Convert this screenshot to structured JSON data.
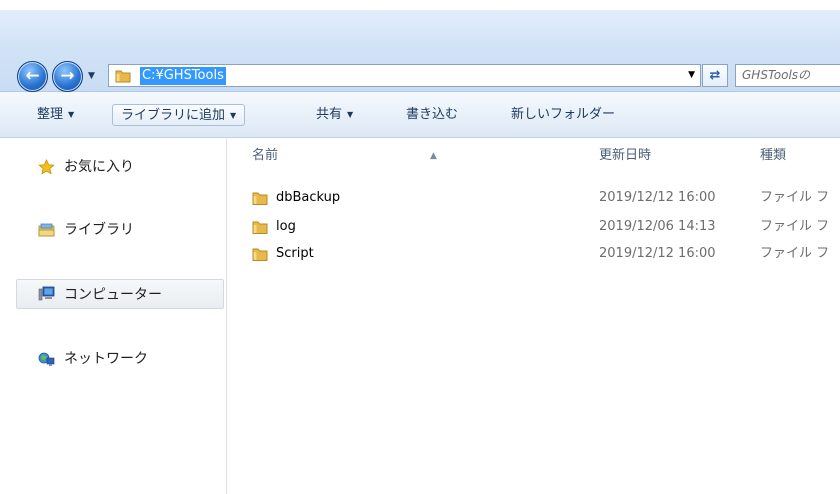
{
  "address": {
    "path": "C:¥GHSTools",
    "search_placeholder": "GHSToolsの"
  },
  "icons": {
    "back": "back-arrow-icon",
    "forward": "forward-arrow-icon",
    "history": "history-dropdown-icon",
    "refresh": "refresh-icon",
    "folder": "folder-icon",
    "star": "favorites-star-icon",
    "library": "library-icon",
    "computer": "computer-icon",
    "network": "network-icon"
  },
  "colors": {
    "selection": "#3399ff",
    "folder": "#e8b84a"
  },
  "toolbar": {
    "organize": "整理",
    "add_to_library": "ライブラリに追加",
    "share": "共有",
    "burn": "書き込む",
    "new_folder": "新しいフォルダー"
  },
  "nav": {
    "favorites": "お気に入り",
    "libraries": "ライブラリ",
    "computer": "コンピューター",
    "network": "ネットワーク"
  },
  "columns": {
    "name": "名前",
    "modified": "更新日時",
    "type": "種類"
  },
  "files": [
    {
      "name": "dbBackup",
      "modified": "2019/12/12 16:00",
      "type": "ファイル フ"
    },
    {
      "name": "log",
      "modified": "2019/12/06 14:13",
      "type": "ファイル フ"
    },
    {
      "name": "Script",
      "modified": "2019/12/12 16:00",
      "type": "ファイル フ"
    }
  ]
}
